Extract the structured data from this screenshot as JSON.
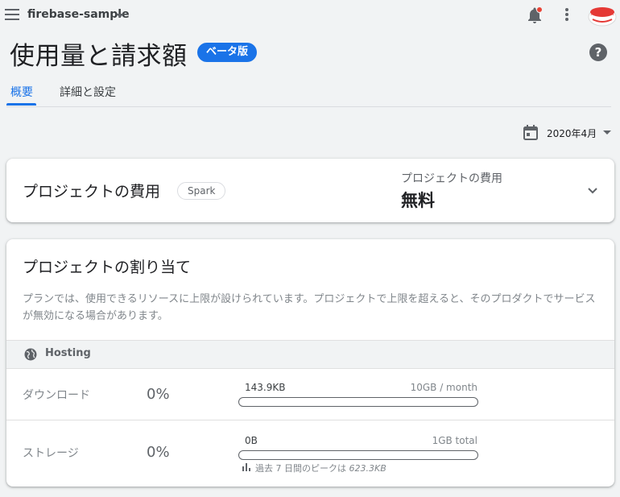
{
  "header": {
    "project_name": "firebase-sample",
    "icons": [
      "menu-icon",
      "notification-bell-icon",
      "more-vert-icon",
      "avatar"
    ]
  },
  "page": {
    "title": "使用量と請求額",
    "badge": "ベータ版"
  },
  "tabs": [
    {
      "label": "概要",
      "active": true
    },
    {
      "label": "詳細と設定",
      "active": false
    }
  ],
  "date_picker": {
    "value": "2020年4月"
  },
  "cost_card": {
    "title": "プロジェクトの費用",
    "plan": "Spark",
    "cost_label": "プロジェクトの費用",
    "cost_value": "無料"
  },
  "allocation_card": {
    "title": "プロジェクトの割り当て",
    "description": "プランでは、使用できるリソースに上限が設けられています。プロジェクトで上限を超えると、そのプロダクトでサービスが無効になる場合があります。",
    "section": "Hosting",
    "rows": [
      {
        "name": "ダウンロード",
        "percent": "0%",
        "used": "143.9KB",
        "limit": "10GB / month",
        "fill": 0.0
      },
      {
        "name": "ストレージ",
        "percent": "0%",
        "used": "0B",
        "limit": "1GB total",
        "fill": 0.0,
        "peak_prefix": "過去 7 日間のピークは",
        "peak_value": "623.3KB"
      }
    ]
  },
  "colors": {
    "accent": "#1a73e8",
    "notification_dot": "#ea4335",
    "background": "#f1f3f4"
  }
}
